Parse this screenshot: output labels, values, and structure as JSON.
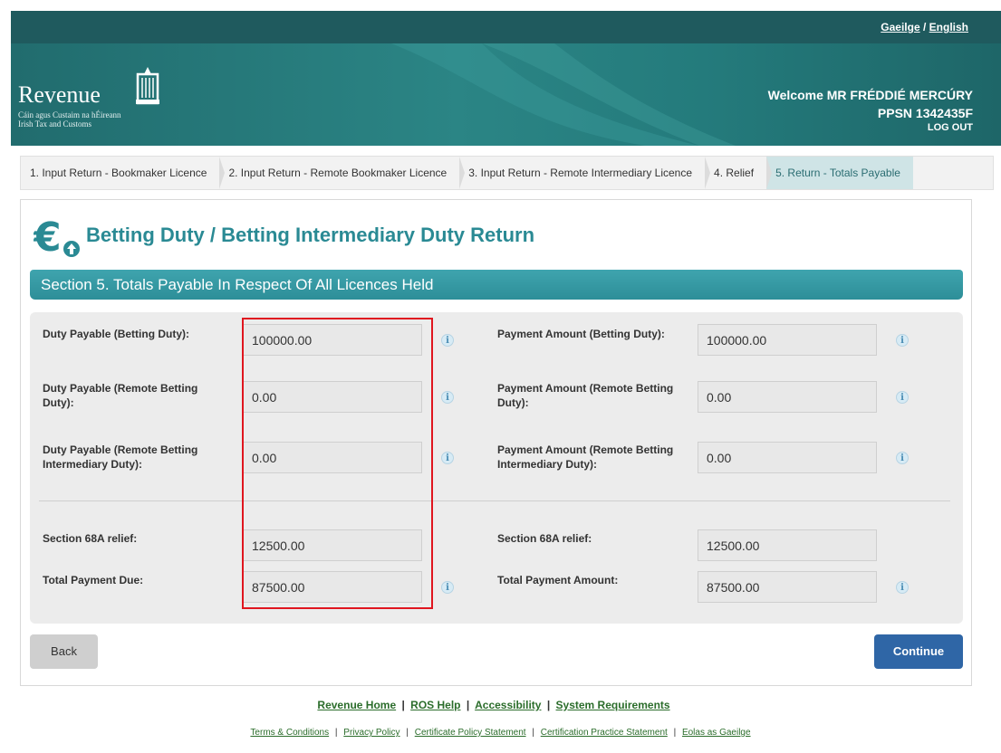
{
  "language": {
    "irish": "Gaeilge",
    "separator": "/",
    "english": "English"
  },
  "header": {
    "logo_word": "Revenue",
    "logo_sub1": "Cáin agus Custaim na hÉireann",
    "logo_sub2": "Irish Tax and Customs",
    "welcome": "Welcome MR FRÉDDIÉ MERCÚRY",
    "ppsn": "PPSN 1342435F",
    "logout": "LOG OUT"
  },
  "steps": [
    {
      "label": "1. Input Return - Bookmaker Licence"
    },
    {
      "label": "2. Input Return - Remote Bookmaker Licence"
    },
    {
      "label": "3. Input Return - Remote Intermediary Licence"
    },
    {
      "label": "4. Relief"
    },
    {
      "label": "5. Return - Totals Payable"
    }
  ],
  "page_title": "Betting Duty / Betting Intermediary Duty Return",
  "section_title": "Section 5. Totals Payable In Respect Of All Licences Held",
  "left_fields": {
    "duty_betting": {
      "label": "Duty Payable (Betting Duty):",
      "value": "100000.00"
    },
    "duty_remote_line1": "Duty Payable (Remote Betting",
    "duty_remote_line2": "Duty):",
    "duty_remote_value": "0.00",
    "duty_interm_line1": "Duty Payable (Remote Betting",
    "duty_interm_line2": "Intermediary Duty):",
    "duty_interm_value": "0.00",
    "relief": {
      "label": "Section 68A relief:",
      "value": "12500.00"
    },
    "total": {
      "label": "Total Payment Due:",
      "value": "87500.00"
    }
  },
  "right_fields": {
    "pay_betting": {
      "label": "Payment Amount (Betting Duty):",
      "value": "100000.00"
    },
    "pay_remote_line1": "Payment Amount (Remote Betting",
    "pay_remote_line2": "Duty):",
    "pay_remote_value": "0.00",
    "pay_interm_line1": "Payment Amount (Remote Betting",
    "pay_interm_line2": "Intermediary Duty):",
    "pay_interm_value": "0.00",
    "relief": {
      "label": "Section 68A relief:",
      "value": "12500.00"
    },
    "total": {
      "label": "Total Payment Amount:",
      "value": "87500.00"
    }
  },
  "info_glyph": "i",
  "buttons": {
    "back": "Back",
    "continue": "Continue"
  },
  "footer_main": [
    "Revenue Home",
    "ROS Help",
    "Accessibility",
    "System Requirements"
  ],
  "footer_sub": [
    "Terms & Conditions",
    "Privacy Policy",
    "Certificate Policy Statement",
    "Certification Practice Statement",
    "Eolas as Gaeilge"
  ],
  "separator": "|",
  "colors": {
    "header": "#247b7c",
    "title": "#2a8a94",
    "section_bar": "#3fa4ae",
    "continue": "#2f66a6",
    "highlight": "#e0161f",
    "footer_link": "#2b6d2b"
  },
  "icons": {
    "euro": "euro-upload-icon",
    "info": "info-icon",
    "harp": "harp-logo-icon"
  }
}
